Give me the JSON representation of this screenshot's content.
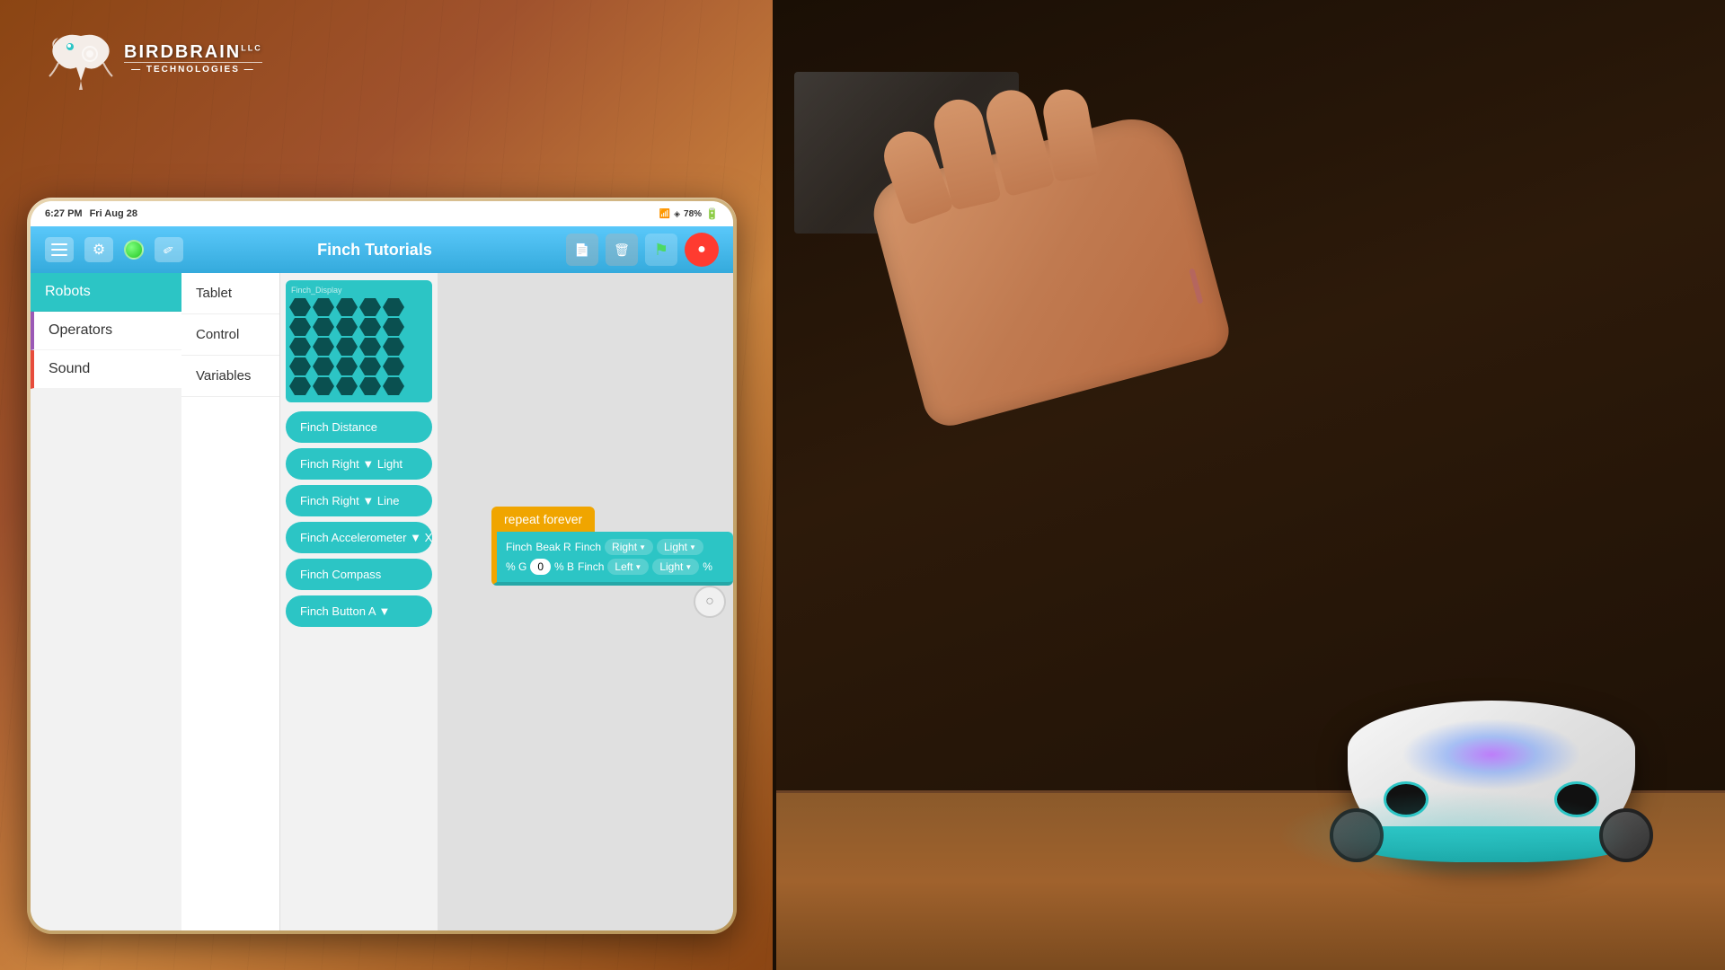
{
  "left_panel": {
    "logo": {
      "birdbrain": "BIRDBRAIN",
      "llc": "LLC",
      "technologies": "— TECHNOLOGIES —",
      "tm": "™"
    }
  },
  "status_bar": {
    "time": "6:27 PM",
    "date": "Fri Aug 28",
    "battery": "78%",
    "wifi": "WiFi",
    "signal": "●●●"
  },
  "nav_bar": {
    "title": "Finch Tutorials",
    "icons": {
      "menu": "☰",
      "gear": "⚙",
      "green_dot": "",
      "pencil": "✏",
      "flag": "⚑",
      "record": "●"
    }
  },
  "sidebar": {
    "items": [
      {
        "label": "Robots",
        "active": true
      },
      {
        "label": "Operators",
        "active": false
      },
      {
        "label": "Sound",
        "active": false
      }
    ]
  },
  "submenu": {
    "items": [
      {
        "label": "Tablet"
      },
      {
        "label": "Control"
      },
      {
        "label": "Variables"
      }
    ]
  },
  "blocks_sidebar": {
    "finch_display_label": "Finch_Display",
    "hex_rows": 5,
    "hex_cols": 5,
    "buttons": [
      {
        "label": "Finch Distance"
      },
      {
        "label": "Finch Right ▼ Light"
      },
      {
        "label": "Finch Right ▼ Line"
      },
      {
        "label": "Finch Accelerometer ▼ X ▼"
      },
      {
        "label": "Finch Compass"
      },
      {
        "label": "Finch Button A ▼"
      }
    ]
  },
  "code_blocks": {
    "repeat_label": "repeat forever",
    "inner_parts": [
      {
        "type": "label",
        "text": "Finch"
      },
      {
        "type": "label",
        "text": "Beak R"
      },
      {
        "type": "label",
        "text": "Finch"
      },
      {
        "type": "dropdown",
        "text": "Right"
      },
      {
        "type": "dropdown",
        "text": "Light"
      },
      {
        "type": "label",
        "text": "% G"
      },
      {
        "type": "input",
        "value": "0"
      },
      {
        "type": "label",
        "text": "% B"
      },
      {
        "type": "label",
        "text": "Finch"
      },
      {
        "type": "dropdown",
        "text": "Left"
      },
      {
        "type": "dropdown",
        "text": "Light"
      },
      {
        "type": "label",
        "text": "%"
      }
    ]
  },
  "colors": {
    "teal": "#2cc5c5",
    "orange": "#f0a500",
    "red": "#ff3b30",
    "purple": "#9b59b6",
    "navBlue": "#34aadc",
    "background": "#e0e0e0"
  }
}
